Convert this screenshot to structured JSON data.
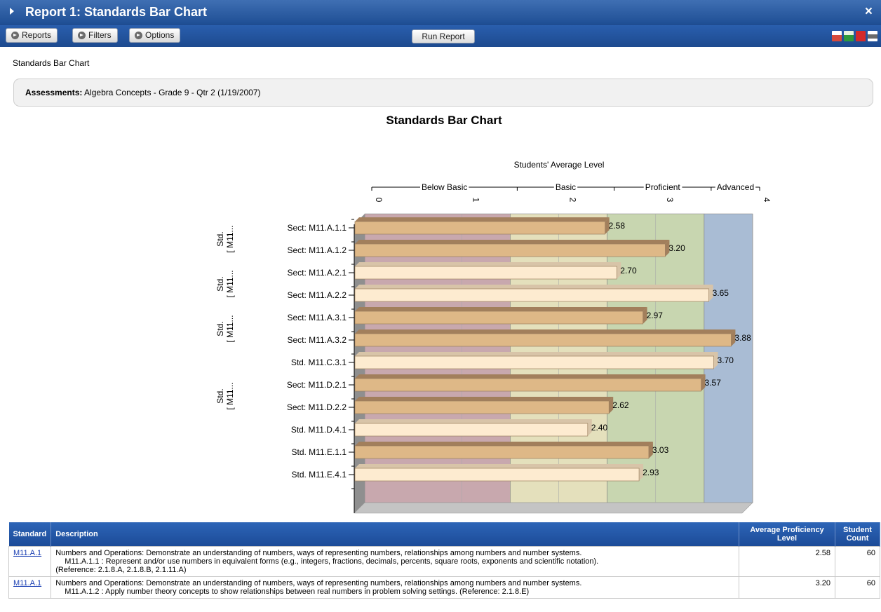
{
  "window": {
    "title": "Report 1: Standards Bar Chart",
    "close": "×"
  },
  "toolbar": {
    "reports": "Reports",
    "filters": "Filters",
    "options": "Options",
    "run": "Run Report",
    "icons": [
      "pdf-export-icon",
      "excel-export-icon",
      "pdf-icon",
      "print-icon"
    ]
  },
  "report": {
    "subtitle": "Standards Bar Chart",
    "assess_label": "Assessments:",
    "assess_value": "Algebra Concepts - Grade 9 - Qtr 2 (1/19/2007)"
  },
  "chart_data": {
    "type": "bar",
    "orientation": "horizontal",
    "title": "Standards Bar Chart",
    "xlabel": "Students' Average Level",
    "xlim": [
      0,
      4
    ],
    "x_ticks": [
      "0",
      "1",
      "2",
      "3",
      "4"
    ],
    "bands": [
      {
        "label": "Below Basic",
        "from": 0,
        "to": 1.5,
        "color": "#c8a8ae"
      },
      {
        "label": "Basic",
        "from": 1.5,
        "to": 2.5,
        "color": "#e4e0bc"
      },
      {
        "label": "Proficient",
        "from": 2.5,
        "to": 3.5,
        "color": "#c8d6b0"
      },
      {
        "label": "Advanced",
        "from": 3.5,
        "to": 4,
        "color": "#a9bcd4"
      }
    ],
    "categories": [
      "Sect: M11.A.1.1",
      "Sect: M11.A.1.2",
      "Sect: M11.A.2.1",
      "Sect: M11.A.2.2",
      "Sect: M11.A.3.1",
      "Sect: M11.A.3.2",
      "Std. M11.C.3.1",
      "Sect: M11.D.2.1",
      "Sect: M11.D.2.2",
      "Std. M11.D.4.1",
      "Std. M11.E.1.1",
      "Std. M11.E.4.1"
    ],
    "values": [
      2.58,
      3.2,
      2.7,
      3.65,
      2.97,
      3.88,
      3.7,
      3.57,
      2.62,
      2.4,
      3.03,
      2.93
    ],
    "value_labels": [
      "2.58",
      "3.20",
      "2.70",
      "3.65",
      "2.97",
      "3.88",
      "3.70",
      "3.57",
      "2.62",
      "2.40",
      "3.03",
      "2.93"
    ],
    "bar_colors": [
      "#deb887",
      "#deb887",
      "#fdebd0",
      "#fdebd0",
      "#deb887",
      "#deb887",
      "#fdebd0",
      "#deb887",
      "#deb887",
      "#fdebd0",
      "#deb887",
      "#fdebd0"
    ],
    "groups": [
      {
        "line1": "Std.",
        "line2": "[ M11...",
        "first": 0,
        "last": 1
      },
      {
        "line1": "Std.",
        "line2": "[ M11...",
        "first": 2,
        "last": 3
      },
      {
        "line1": "Std.",
        "line2": "[ M11...",
        "first": 4,
        "last": 5
      },
      {
        "line1": "Std.",
        "line2": "[ M11...",
        "first": 7,
        "last": 8
      }
    ]
  },
  "table": {
    "headers": {
      "standard": "Standard",
      "description": "Description",
      "avg": "Average Proficiency Level",
      "count": "Student Count"
    },
    "rows": [
      {
        "standard": "M11.A.1",
        "desc1": "Numbers and Operations: Demonstrate an understanding of numbers, ways of representing numbers, relationships among numbers and number systems.",
        "desc2": "M11.A.1.1 : Represent and/or use numbers in equivalent forms (e.g., integers, fractions, decimals, percents, square roots, exponents and scientific notation).",
        "desc3": "(Reference: 2.1.8.A, 2.1.8.B, 2.1.11.A)",
        "avg": "2.58",
        "count": "60"
      },
      {
        "standard": "M11.A.1",
        "desc1": "Numbers and Operations: Demonstrate an understanding of numbers, ways of representing numbers, relationships among numbers and number systems.",
        "desc2": "M11.A.1.2 : Apply number theory concepts to show relationships between real numbers in problem solving settings. (Reference: 2.1.8.E)",
        "desc3": "",
        "avg": "3.20",
        "count": "60"
      }
    ]
  }
}
